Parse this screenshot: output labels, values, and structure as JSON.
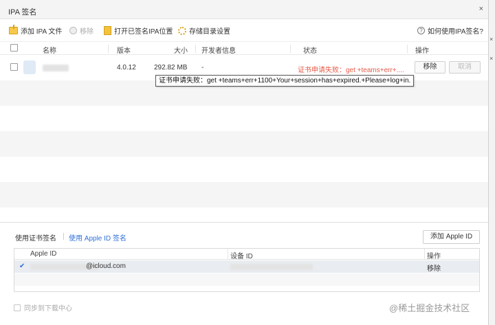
{
  "window": {
    "title": "IPA 签名",
    "close_glyph": "×"
  },
  "toolbar": {
    "add_ipa": "添加 IPA 文件",
    "remove": "移除",
    "open_signed": "打开已签名IPA位置",
    "storage_settings": "存储目录设置",
    "help": "如何使用IPA签名?"
  },
  "table": {
    "headers": {
      "name": "名称",
      "version": "版本",
      "size": "大小",
      "developer": "开发者信息",
      "status": "状态",
      "actions": "操作"
    },
    "rows": [
      {
        "version": "4.0.12",
        "size": "292.82 MB",
        "developer": "-",
        "status": "证书申请失败：get +teams+err+....",
        "remove_label": "移除",
        "cancel_label": "取消"
      }
    ]
  },
  "tooltip": {
    "text": "证书申请失败：get +teams+err+1100+Your+session+has+expired.+Please+log+in."
  },
  "sign_tabs": {
    "cert": "使用证书签名",
    "apple_id": "使用 Apple ID 签名"
  },
  "add_apple_id": "添加 Apple ID",
  "id_table": {
    "headers": {
      "apple_id": "Apple ID",
      "device_id": "设备 ID",
      "actions": "操作"
    },
    "rows": [
      {
        "check": "✔",
        "email_suffix": "@icloud.com",
        "remove_label": "移除"
      }
    ]
  },
  "sync_label": "同步到下载中心",
  "watermark": "@稀土掘金技术社区",
  "colors": {
    "error": "#e65b4a",
    "link": "#2e6fd8",
    "stripe": "#f5f5f5"
  }
}
